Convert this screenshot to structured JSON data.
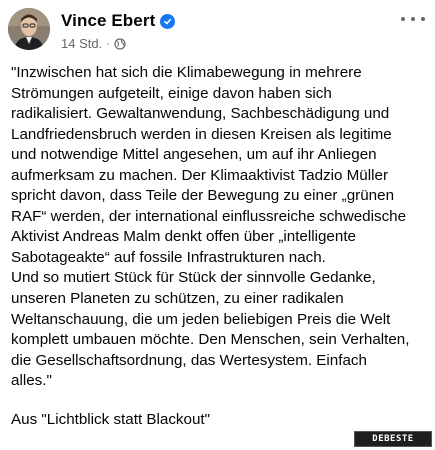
{
  "post": {
    "author": "Vince Ebert",
    "verified": true,
    "timestamp": "14 Std.",
    "separator": "·",
    "privacy_icon": "globe-icon",
    "more_icon": "more-horizontal-icon",
    "body_lines": [
      "\"Inzwischen hat sich die Klimabewegung in mehrere",
      "Strömungen aufgeteilt, einige davon haben sich",
      "radikalisiert. Gewaltanwendung, Sachbeschädigung und",
      "Landfriedensbruch werden in diesen Kreisen als legitime",
      "und notwendige Mittel angesehen, um auf ihr Anliegen",
      "aufmerksam zu machen. Der Klimaaktivist Tadzio Müller",
      "spricht davon, dass Teile der Bewegung zu einer „grünen",
      "RAF“ werden, der international einflussreiche schwedische",
      "Aktivist Andreas Malm denkt offen über „intelligente",
      "Sabotageakte“ auf fossile Infrastrukturen nach.",
      "Und so mutiert Stück für Stück der sinnvolle Gedanke,",
      "unseren Planeten zu schützen, zu einer radikalen",
      "Weltanschauung, die um jeden beliebigen Preis die Welt",
      "komplett umbauen möchte. Den Menschen, sein Verhalten,",
      "die Gesellschaftsordnung, das Wertesystem. Einfach",
      "alles.\""
    ],
    "source": "Aus \"Lichtblick statt Blackout\""
  },
  "watermark": "DEBESTE"
}
